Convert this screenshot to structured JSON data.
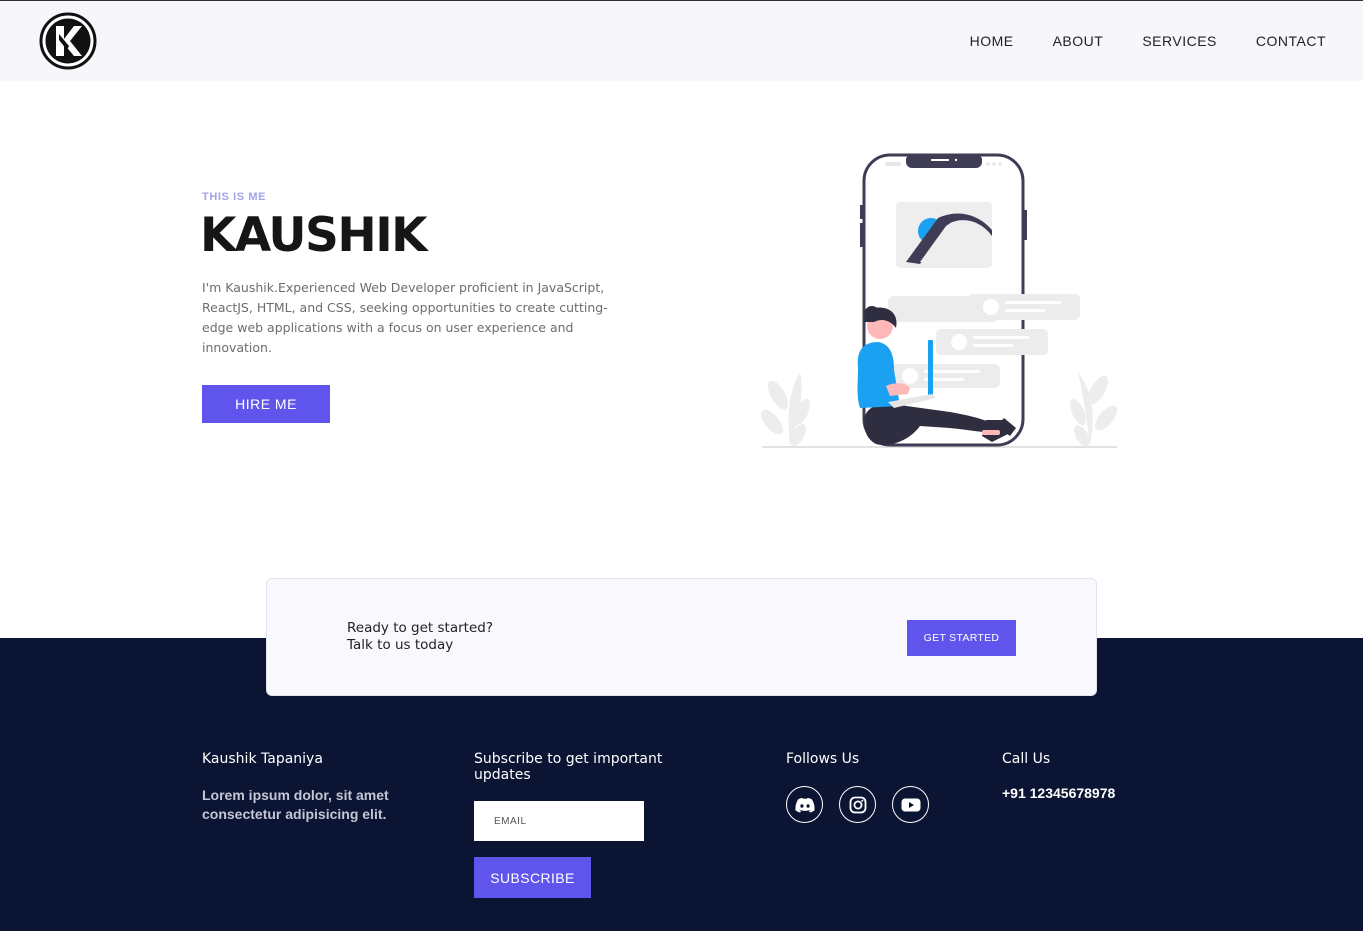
{
  "header": {
    "logo_icon": "k-monogram-logo",
    "nav": [
      "HOME",
      "ABOUT",
      "SERVICES",
      "CONTACT"
    ]
  },
  "hero": {
    "eyebrow": "THIS IS ME",
    "title": "KAUSHIK",
    "description": "I'm Kaushik.Experienced Web Developer proficient in JavaScript, ReactJS, HTML, and CSS, seeking opportunities to create cutting-edge web applications with a focus on user experience and innovation.",
    "cta_label": "HIRE ME",
    "illustration": "woman-with-laptop-and-phone-illustration"
  },
  "cta_box": {
    "line1": "Ready to get started?",
    "line2": "Talk to us today",
    "button_label": "GET STARTED"
  },
  "footer": {
    "about_title": "Kaushik Tapaniya",
    "about_text": "Lorem ipsum dolor, sit amet consectetur adipisicing elit.",
    "subscribe_title": "Subscribe to get important updates",
    "email_placeholder": "EMAIL",
    "subscribe_label": "SUBSCRIBE",
    "follow_title": "Follows Us",
    "social_icons": [
      "discord-icon",
      "instagram-icon",
      "youtube-icon"
    ],
    "call_title": "Call Us",
    "phone": "+91 12345678978"
  },
  "colors": {
    "accent": "#5f55ec",
    "footer_bg": "#0b1433",
    "header_bg": "#f6f6fb",
    "eyebrow": "#a3a3e8",
    "figure_shirt": "#1aa1f2"
  }
}
